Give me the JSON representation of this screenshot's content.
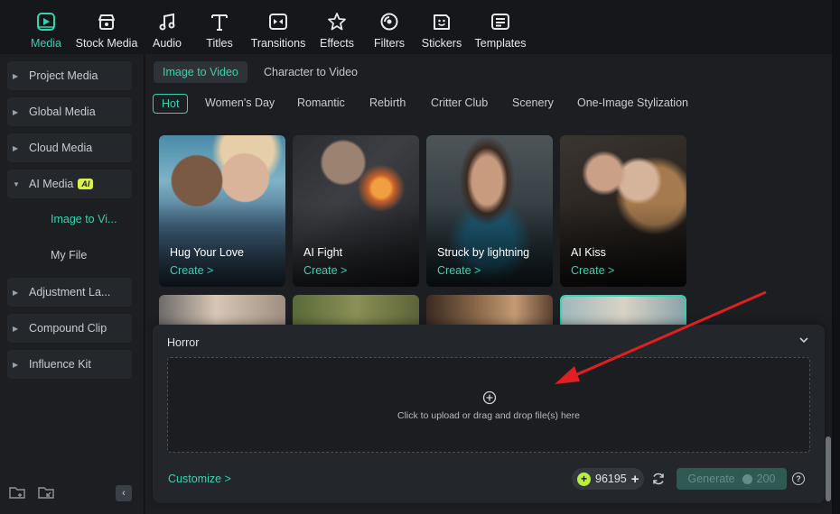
{
  "toolbar": {
    "items": [
      {
        "label": "Media",
        "icon": "media-icon"
      },
      {
        "label": "Stock Media",
        "icon": "stock-media-icon"
      },
      {
        "label": "Audio",
        "icon": "audio-icon"
      },
      {
        "label": "Titles",
        "icon": "titles-icon"
      },
      {
        "label": "Transitions",
        "icon": "transitions-icon"
      },
      {
        "label": "Effects",
        "icon": "effects-icon"
      },
      {
        "label": "Filters",
        "icon": "filters-icon"
      },
      {
        "label": "Stickers",
        "icon": "stickers-icon"
      },
      {
        "label": "Templates",
        "icon": "templates-icon"
      }
    ],
    "active": "Media"
  },
  "sidebar": {
    "items": [
      {
        "label": "Project Media"
      },
      {
        "label": "Global Media"
      },
      {
        "label": "Cloud Media"
      },
      {
        "label": "AI Media",
        "badge": "AI"
      },
      {
        "label": "Adjustment La..."
      },
      {
        "label": "Compound Clip"
      },
      {
        "label": "Influence Kit"
      }
    ],
    "subitems": [
      {
        "label": "Image to Vi...",
        "active": true
      },
      {
        "label": "My File"
      }
    ]
  },
  "tabs": [
    {
      "label": "Image to Video",
      "active": true
    },
    {
      "label": "Character to Video"
    }
  ],
  "chips": [
    "Hot",
    "Women's Day",
    "Romantic",
    "Rebirth",
    "Critter Club",
    "Scenery",
    "One-Image Stylization"
  ],
  "cards": [
    {
      "title": "Hug Your Love",
      "action": "Create >"
    },
    {
      "title": "AI Fight",
      "action": "Create >"
    },
    {
      "title": "Struck by lightning",
      "action": "Create >"
    },
    {
      "title": "AI Kiss",
      "action": "Create >"
    }
  ],
  "panel": {
    "title": "Horror",
    "upload_text": "Click to upload or drag and drop file(s) here",
    "customize": "Customize >",
    "credits": "96195",
    "generate_label": "Generate",
    "generate_cost": "200",
    "help": "?"
  },
  "colors": {
    "accent": "#35d3b2",
    "coin": "#b8ef3c",
    "ai_badge": "#d9f14b",
    "annotation_arrow": "#e02020"
  }
}
